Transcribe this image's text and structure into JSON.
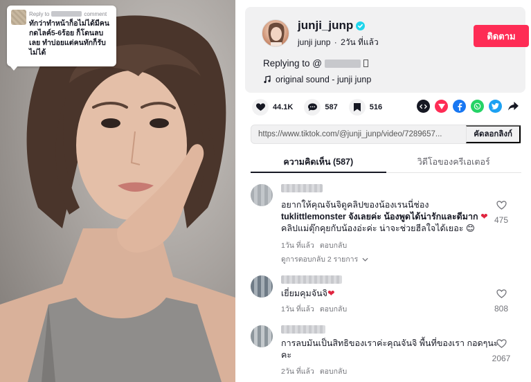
{
  "video": {
    "reply_bubble": {
      "header_prefix": "Reply to",
      "header_suffix": "comment",
      "text": "ทักว่าทำหน้าก็อไม่ได้มีคนกดไลค์5-6ร้อย ก็โดนลบเลย ทำบ่อยแต่คนทักก็รับไม่ได้"
    }
  },
  "author": {
    "username": "junji_junp",
    "nickname": "junji junp",
    "separator": "·",
    "time_ago": "2วัน ที่แล้ว",
    "follow_label": "ติดตาม",
    "replying_to": "Replying to @",
    "sound": "original sound - junji junp"
  },
  "stats": {
    "likes": "44.1K",
    "comments": "587",
    "saves": "516"
  },
  "share_icons": [
    "embed-icon",
    "send-icon",
    "facebook-icon",
    "whatsapp-icon",
    "twitter-icon",
    "share-arrow-icon"
  ],
  "colors": {
    "accent": "#fe2c55",
    "verified": "#20d5ec",
    "facebook": "#1877f2",
    "whatsapp": "#25d366",
    "twitter": "#1da1f2",
    "send": "#fe2c55",
    "embed": "#161823"
  },
  "link": {
    "url": "https://www.tiktok.com/@junji_junp/video/7289657...",
    "copy_label": "คัดลอกลิงก์"
  },
  "tabs": [
    {
      "label": "ความคิดเห็น (587)",
      "active": true
    },
    {
      "label": "วิดีโอของครีเอเตอร์",
      "active": false
    }
  ],
  "comments": [
    {
      "text_lines": [
        "อยากให้คุณจันจิดูคลิปของน้องเรนนี่ช่อง",
        "tuklittlemonster จังเลยค่ะ น้องพูดได้น่ารักและดีมาก",
        "คลิปแม่ตุ๊กคุยกับน้องอ่ะค่ะ น่าจะช่วยฮีลใจได้เยอะ"
      ],
      "time": "1วัน ที่แล้ว",
      "reply_label": "ตอบกลับ",
      "view_replies": "ดูการตอบกลับ 2 รายการ",
      "likes": "475"
    },
    {
      "text_lines": [
        "เยี่ยมคุมจันจิ"
      ],
      "time": "1วัน ที่แล้ว",
      "reply_label": "ตอบกลับ",
      "likes": "808"
    },
    {
      "text_lines": [
        "การลบมันเป็นสิทธิของเราค่ะคุณจันจิ พื้นที่ของเรา กอดๆนะ",
        "คะ"
      ],
      "time": "2วัน ที่แล้ว",
      "reply_label": "ตอบกลับ",
      "likes": "2067"
    }
  ]
}
